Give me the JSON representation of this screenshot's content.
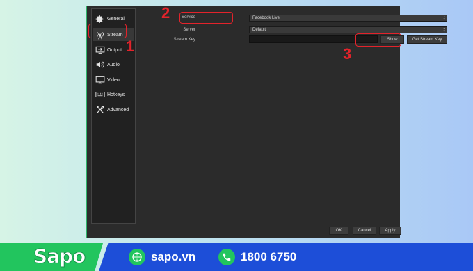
{
  "sidebar": {
    "items": [
      {
        "label": "General",
        "icon": "gear-icon"
      },
      {
        "label": "Stream",
        "icon": "antenna-icon"
      },
      {
        "label": "Output",
        "icon": "output-icon"
      },
      {
        "label": "Audio",
        "icon": "speaker-icon"
      },
      {
        "label": "Video",
        "icon": "monitor-icon"
      },
      {
        "label": "Hotkeys",
        "icon": "keyboard-icon"
      },
      {
        "label": "Advanced",
        "icon": "tools-icon"
      }
    ]
  },
  "form": {
    "service_label": "Service",
    "service_value": "Facebook Live",
    "server_label": "Server",
    "server_value": "Default",
    "stream_key_label": "Stream Key",
    "stream_key_value": "",
    "show_label": "Show",
    "get_key_label": "Get Stream Key"
  },
  "dialog_buttons": {
    "ok": "OK",
    "cancel": "Cancel",
    "apply": "Apply"
  },
  "annotations": {
    "step1": "1",
    "step2": "2",
    "step3": "3"
  },
  "footer": {
    "brand": "Sapo",
    "website": "sapo.vn",
    "phone": "1800 6750"
  },
  "colors": {
    "highlight": "#e3232b",
    "footer_green": "#22c55e",
    "footer_blue": "#1d4ed8"
  }
}
